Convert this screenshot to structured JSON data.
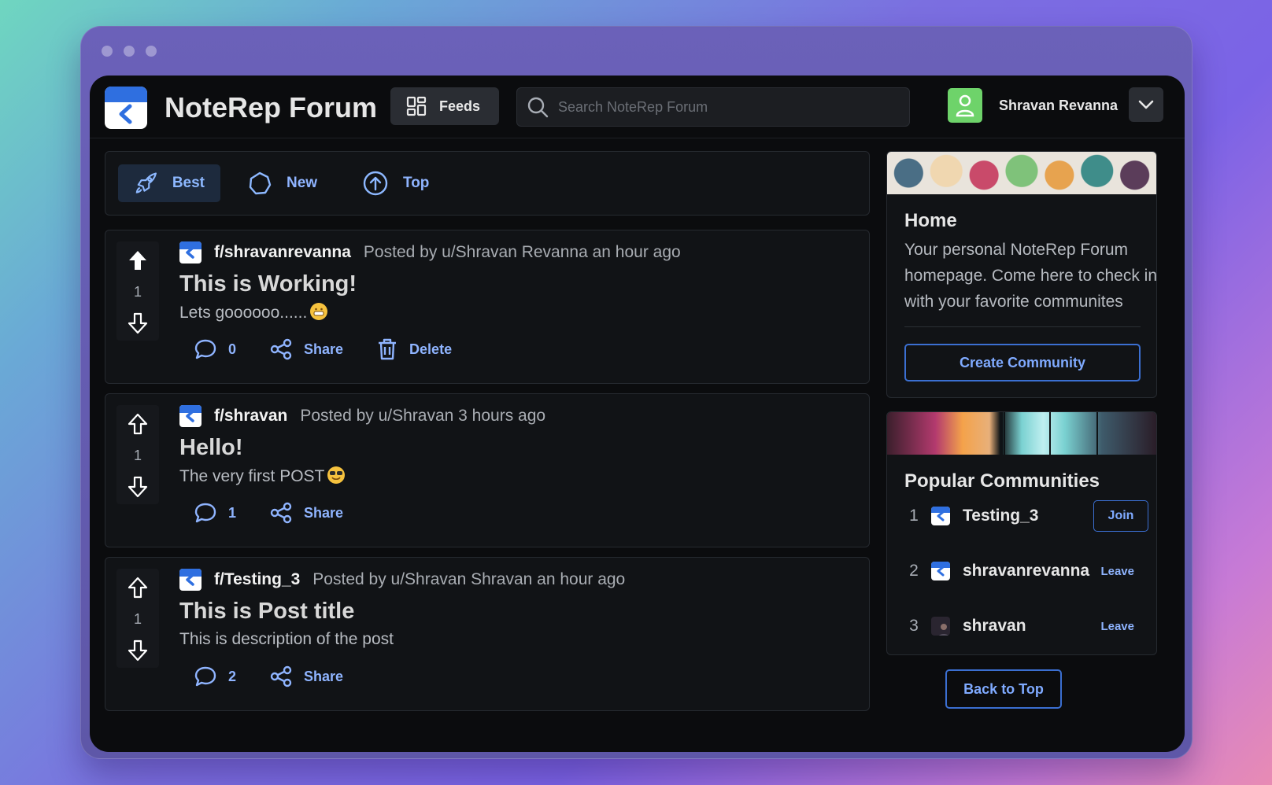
{
  "header": {
    "brand": "NoteRep Forum",
    "feeds_label": "Feeds",
    "search_placeholder": "Search NoteRep Forum",
    "username": "Shravan Revanna",
    "colors": {
      "accent": "#8fb4ff",
      "avatar": "#6ed36a",
      "logo_band": "#2f6fe0"
    }
  },
  "sort": {
    "items": [
      {
        "label": "Best",
        "icon": "rocket-icon",
        "active": true
      },
      {
        "label": "New",
        "icon": "circle-icon",
        "active": false
      },
      {
        "label": "Top",
        "icon": "arrow-up-circle-icon",
        "active": false
      }
    ]
  },
  "posts": [
    {
      "votes": "1",
      "community": "f/shravanrevanna",
      "posted": "Posted by u/Shravan Revanna an hour ago",
      "title": "This is Working!",
      "body": "Lets goooooo......",
      "comments": "0",
      "share_label": "Share",
      "delete_label": "Delete"
    },
    {
      "votes": "1",
      "community": "f/shravan",
      "posted": "Posted by u/Shravan 3 hours ago",
      "title": "Hello!",
      "body": "The very first POST",
      "comments": "1",
      "share_label": "Share"
    },
    {
      "votes": "1",
      "community": "f/Testing_3",
      "posted": "Posted by u/Shravan Shravan an hour ago",
      "title": "This is Post title",
      "body": "This is description of the post",
      "comments": "2",
      "share_label": "Share"
    }
  ],
  "sidebar": {
    "home_title": "Home",
    "home_desc": "Your personal NoteRep Forum homepage. Come here to check in with your favorite communites",
    "create_label": "Create Community",
    "popular_title": "Popular Communities",
    "communities": [
      {
        "rank": "1",
        "name": "Testing_3",
        "action": "Join"
      },
      {
        "rank": "2",
        "name": "shravanrevanna",
        "action": "Leave"
      },
      {
        "rank": "3",
        "name": "shravan",
        "action": "Leave"
      }
    ],
    "back_to_top": "Back to Top"
  }
}
